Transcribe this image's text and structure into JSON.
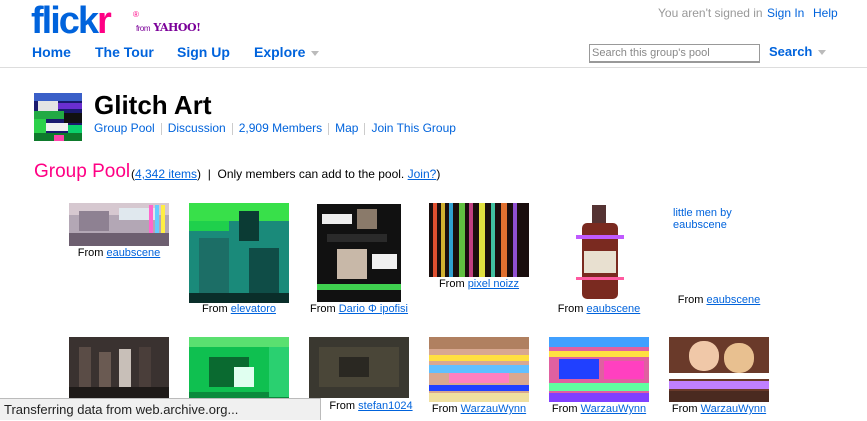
{
  "header": {
    "logo_part1": "flick",
    "logo_part2": "r",
    "logo_from": "from",
    "logo_yahoo": "YAHOO!",
    "not_signed_in": "You aren't signed in",
    "sign_in": "Sign In",
    "help": "Help"
  },
  "nav": {
    "home": "Home",
    "tour": "The Tour",
    "signup": "Sign Up",
    "explore": "Explore",
    "search_placeholder": "Search this group's pool",
    "search_button": "Search"
  },
  "group": {
    "title": "Glitch Art",
    "links": [
      "Group Pool",
      "Discussion",
      "2,909 Members",
      "Map",
      "Join This Group"
    ]
  },
  "pool": {
    "title": "Group Pool",
    "count_link": "4,342 items",
    "info_text": "Only members can add to the pool.",
    "join_link": "Join?",
    "from_label": "From",
    "text_thumb_title": "little men by eaubscene",
    "items": [
      {
        "user": "eaubscene"
      },
      {
        "user": "elevatoro"
      },
      {
        "user": "Dario Φ ipofisi"
      },
      {
        "user": "pixel noizz"
      },
      {
        "user": "eaubscene"
      },
      {
        "user": "eaubscene"
      },
      {
        "user": ""
      },
      {
        "user": ""
      },
      {
        "user": "stefan1024"
      },
      {
        "user": "WarzauWynn"
      },
      {
        "user": "WarzauWynn"
      },
      {
        "user": "WarzauWynn"
      }
    ]
  },
  "statusbar": {
    "text": "Transferring data from web.archive.org..."
  },
  "colors": {
    "link_blue": "#0063dc",
    "flickr_pink": "#ff0084"
  }
}
